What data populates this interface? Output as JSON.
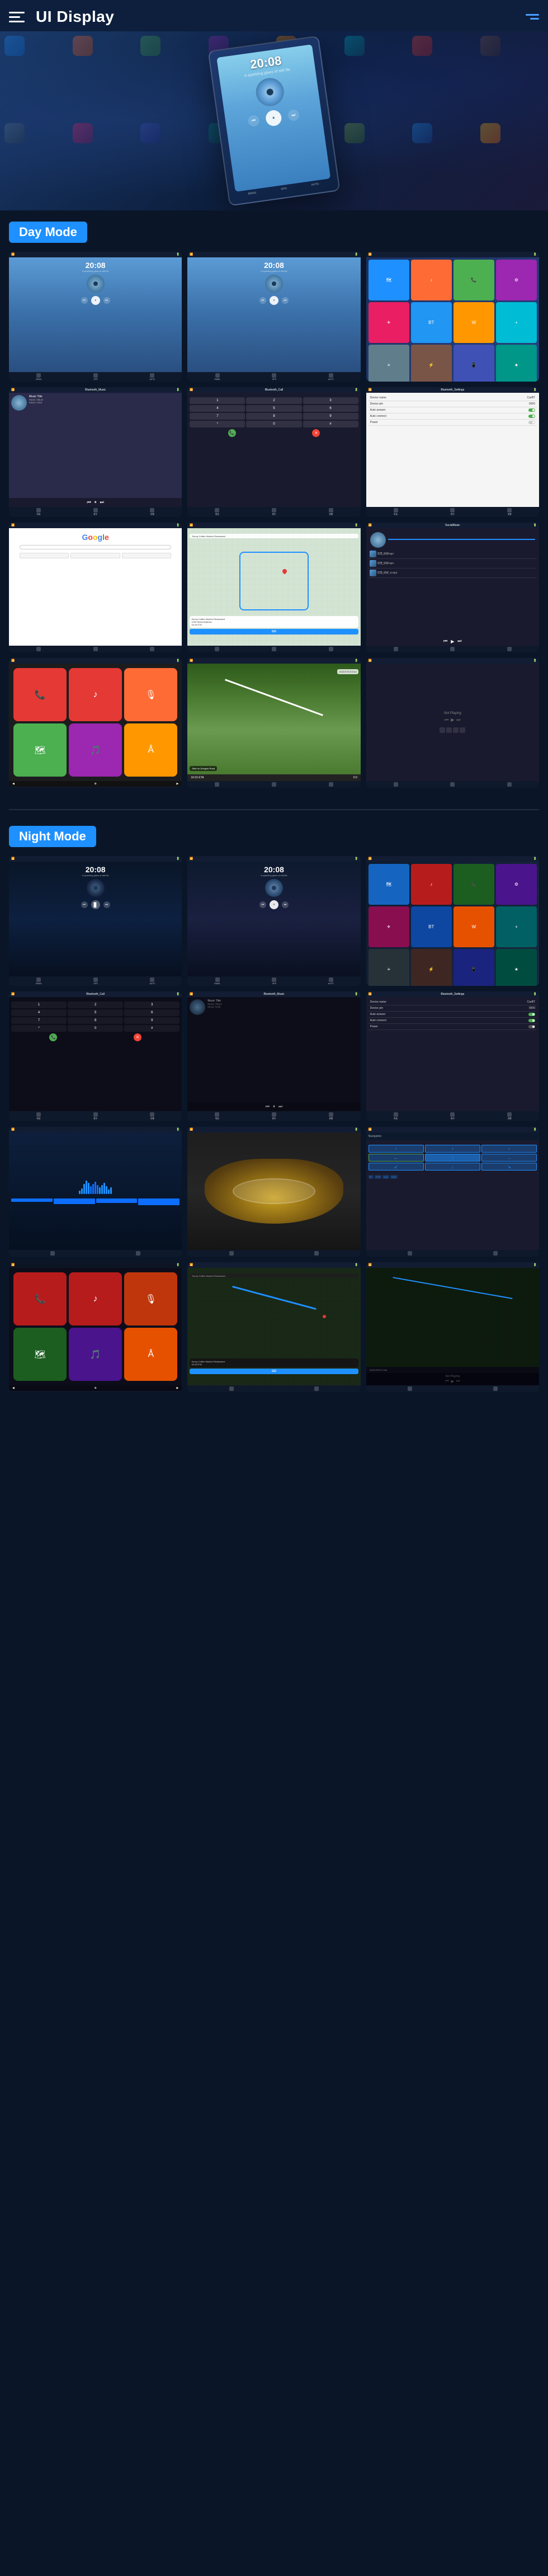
{
  "header": {
    "title": "UI Display",
    "menu_icon_label": "menu",
    "hamburger_label": "navigation menu"
  },
  "mode_day": {
    "label": "Day Mode"
  },
  "mode_night": {
    "label": "Night Mode"
  },
  "music": {
    "title": "Music Title",
    "album": "Music Album",
    "artist": "Music Artist",
    "time": "20:08",
    "subtitle": "A sparkling glass of still life"
  },
  "settings": {
    "title": "Bluetooth_Settings",
    "device_name_label": "Device name",
    "device_name_value": "CarBT",
    "device_pin_label": "Device pin",
    "device_pin_value": "0000",
    "auto_answer_label": "Auto answer",
    "auto_connect_label": "Auto connect",
    "power_label": "Power"
  },
  "bluetooth_music": {
    "title": "Bluetooth_Music"
  },
  "bluetooth_call": {
    "title": "Bluetooth_Call"
  },
  "social_music": {
    "title": "SocialMusic",
    "tracks": [
      "华茂_好好mp4",
      "华茂_好好mp4",
      "华茂_好好_II.mp3"
    ]
  },
  "navigation": {
    "restaurant_name": "Sunny Coffee Modern Restaurant",
    "address": "1234 Street Address",
    "eta_label": "16:16 ETA",
    "distance_label": "0.0",
    "go_label": "GO",
    "direction_label": "Start on Donglue Road",
    "road_distance": "19/16 ETA  9.0 km",
    "not_playing_label": "Not Playing"
  },
  "google": {
    "logo": "Google",
    "logo_colors": [
      "#4285F4",
      "#EA4335",
      "#FBBC05",
      "#34A853",
      "#4285F4",
      "#EA4335"
    ]
  },
  "colors": {
    "blue": "#1e90ff",
    "dark_bg": "#0a1628",
    "card_bg": "#1a2a4a",
    "day_badge": "#1e90ff",
    "night_badge": "#1e90ff"
  },
  "app_icons": {
    "phone": "📞",
    "music": "♪",
    "maps": "🗺",
    "settings": "⚙",
    "messages": "💬",
    "calendar": "📅",
    "weather": "☀",
    "camera": "📷",
    "mail": "✉",
    "spotify": "🎵",
    "podcast": "🎙",
    "appstore": "🅐"
  },
  "dial_buttons": [
    "1",
    "2",
    "3",
    "4",
    "5",
    "6",
    "7",
    "8",
    "9",
    "*",
    "0",
    "#"
  ],
  "wave_heights": [
    6,
    10,
    14,
    18,
    22,
    16,
    12,
    20,
    24,
    18,
    14,
    10,
    16,
    22,
    18,
    12,
    8,
    14,
    20,
    16,
    12,
    18,
    24,
    20,
    14,
    10,
    16,
    12,
    8,
    6
  ]
}
